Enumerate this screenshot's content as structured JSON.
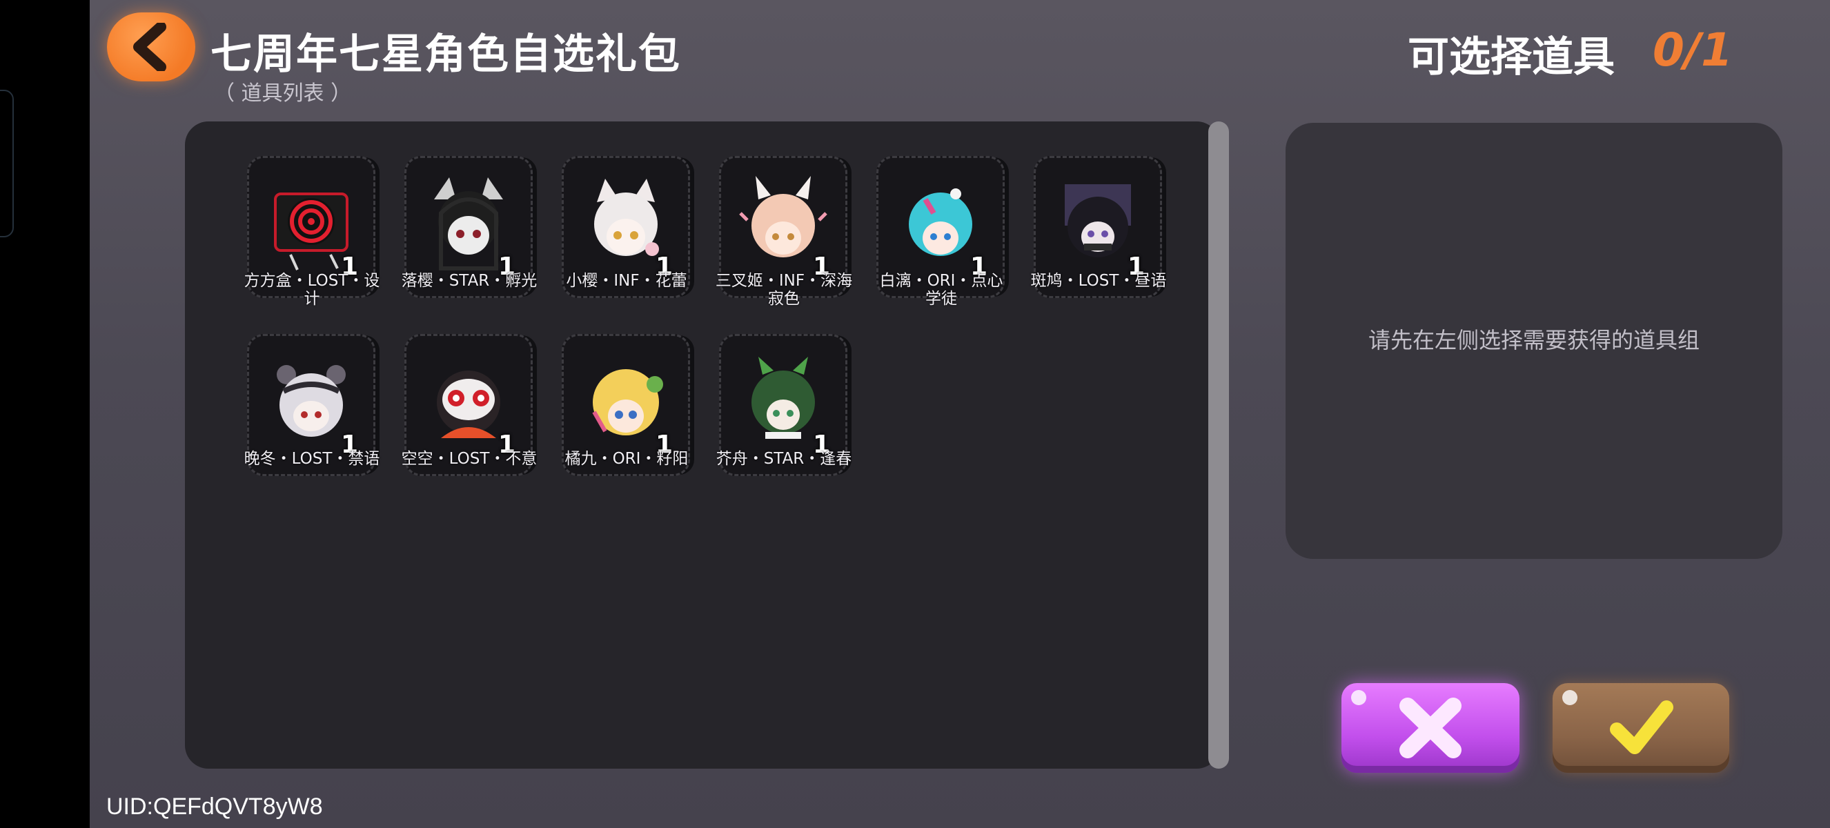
{
  "header": {
    "title": "七周年七星角色自选礼包",
    "subtitle": "（ 道具列表 ）",
    "select_label": "可选择道具",
    "select_count": "0/1"
  },
  "items": [
    {
      "name": "方方盒・LOST・设计",
      "qty": "1"
    },
    {
      "name": "落樱・STAR・孵光",
      "qty": "1"
    },
    {
      "name": "小樱・INF・花蕾",
      "qty": "1"
    },
    {
      "name": "三叉姬・INF・深海寂色",
      "qty": "1"
    },
    {
      "name": "白漓・ORI・点心学徒",
      "qty": "1"
    },
    {
      "name": "斑鸠・LOST・昼语",
      "qty": "1"
    },
    {
      "name": "晚冬・LOST・禁语",
      "qty": "1"
    },
    {
      "name": "空空・LOST・不意",
      "qty": "1"
    },
    {
      "name": "橘九・ORI・籽阳",
      "qty": "1"
    },
    {
      "name": "芥舟・STAR・逢春",
      "qty": "1"
    }
  ],
  "detail": {
    "hint": "请先在左侧选择需要获得的道具组"
  },
  "footer": {
    "uid": "UID:QEFdQVT8yW8"
  },
  "colors": {
    "accent_orange": "#f07e34",
    "cancel_purple": "#c24fec",
    "confirm_brown": "#8a6448"
  }
}
